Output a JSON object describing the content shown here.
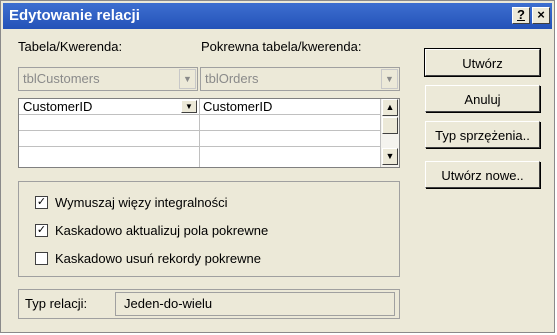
{
  "window": {
    "title": "Edytowanie relacji",
    "help_label": "?",
    "close_label": "×"
  },
  "left": {
    "table_label": "Tabela/Kwerenda:",
    "table_value": "tblCustomers",
    "related_label": "Pokrewna tabela/kwerenda:",
    "related_value": "tblOrders"
  },
  "fields_grid": {
    "rows": [
      {
        "left": "CustomerID",
        "right": "CustomerID"
      },
      {
        "left": "",
        "right": ""
      },
      {
        "left": "",
        "right": ""
      },
      {
        "left": "",
        "right": ""
      }
    ]
  },
  "options": {
    "enforce_integrity": {
      "label": "Wymuszaj więzy integralności",
      "checked": true
    },
    "cascade_update": {
      "label": "Kaskadowo aktualizuj pola pokrewne",
      "checked": true
    },
    "cascade_delete": {
      "label": "Kaskadowo usuń rekordy pokrewne",
      "checked": false
    }
  },
  "relationship": {
    "label": "Typ relacji:",
    "value": "Jeden-do-wielu"
  },
  "buttons": {
    "create": "Utwórz",
    "cancel": "Anuluj",
    "join_type": "Typ sprzężenia..",
    "create_new": "Utwórz nowe.."
  }
}
